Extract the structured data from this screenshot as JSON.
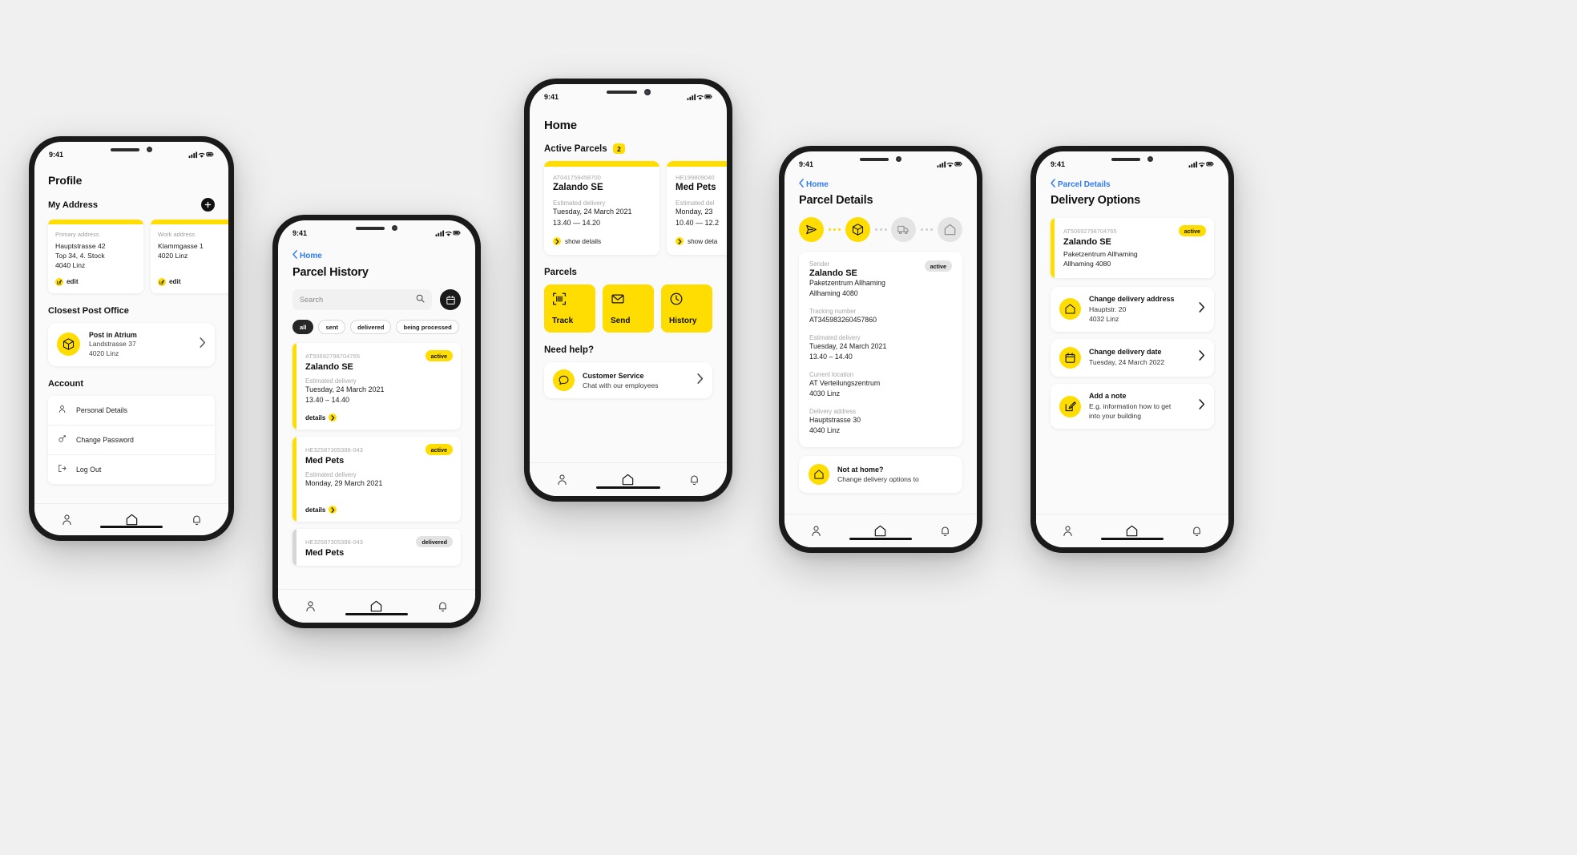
{
  "theme": {
    "accent": "#FFDD00",
    "bg": "#f0f0f0",
    "link": "#2e7bf6",
    "dark": "#1a1a1a"
  },
  "status_bar": {
    "time": "9:41"
  },
  "profile": {
    "title": "Profile",
    "my_address_heading": "My Address",
    "addresses": [
      {
        "label": "Primary address",
        "line1": "Hauptstrasse 42",
        "line2": "Top 34, 4. Stock",
        "line3": "4040 Linz",
        "edit": "edit"
      },
      {
        "label": "Work address",
        "line1": "Klammgasse 1",
        "line2": "4020 Linz",
        "line3": "",
        "edit": "edit"
      }
    ],
    "post_office_heading": "Closest Post Office",
    "post_office": {
      "name": "Post in Atrium",
      "street": "Landstrasse 37",
      "city": "4020 Linz"
    },
    "account_heading": "Account",
    "account_items": [
      {
        "label": "Personal Details",
        "icon": "person-icon"
      },
      {
        "label": "Change Password",
        "icon": "key-icon"
      },
      {
        "label": "Log Out",
        "icon": "logout-icon"
      }
    ]
  },
  "history": {
    "back": "Home",
    "title": "Parcel History",
    "search_placeholder": "Search",
    "calendar_icon": "calendar-icon",
    "filters": [
      {
        "label": "all",
        "selected": true
      },
      {
        "label": "sent",
        "selected": false
      },
      {
        "label": "delivered",
        "selected": false
      },
      {
        "label": "being processed",
        "selected": false
      }
    ],
    "parcels": [
      {
        "tracking": "AT50692798704765",
        "sender": "Zalando SE",
        "status": "active",
        "est_label": "Estimated delivery",
        "date": "Tuesday, 24 March 2021",
        "time": "13.40 – 14.40",
        "details": "details"
      },
      {
        "tracking": "HE32587305386-043",
        "sender": "Med Pets",
        "status": "active",
        "est_label": "Estimated delivery",
        "date": "Monday, 29 March 2021",
        "time": "",
        "details": "details"
      },
      {
        "tracking": "HE32587305386-043",
        "sender": "Med Pets",
        "status": "delivered",
        "est_label": "",
        "date": "",
        "time": "",
        "details": ""
      }
    ]
  },
  "home": {
    "title": "Home",
    "active_heading": "Active Parcels",
    "active_count": "2",
    "active_parcels": [
      {
        "tracking": "AT041759458700",
        "sender": "Zalando SE",
        "est_label": "Estimated delivery",
        "date": "Tuesday, 24 March 2021",
        "time": "13.40 — 14.20",
        "cta": "show details"
      },
      {
        "tracking": "HE199809040",
        "sender": "Med Pets",
        "est_label": "Estimated del",
        "date": "Monday, 23",
        "time": "10.40 — 12.2",
        "cta": "show deta"
      }
    ],
    "parcels_heading": "Parcels",
    "tiles": [
      {
        "label": "Track",
        "icon": "barcode-scan-icon"
      },
      {
        "label": "Send",
        "icon": "envelope-icon"
      },
      {
        "label": "History",
        "icon": "clock-icon"
      }
    ],
    "help_heading": "Need help?",
    "help_card": {
      "title": "Customer Service",
      "subtitle": "Chat with our employees",
      "icon": "chat-bubble-icon"
    }
  },
  "details": {
    "back": "Home",
    "title": "Parcel Details",
    "steps": [
      {
        "icon": "send-arrow-icon",
        "state": "on"
      },
      {
        "icon": "box-icon",
        "state": "on"
      },
      {
        "icon": "truck-icon",
        "state": "off"
      },
      {
        "icon": "home-icon",
        "state": "off"
      }
    ],
    "sender_label": "Sender",
    "sender_name": "Zalando SE",
    "sender_line1": "Paketzentrum Allhaming",
    "sender_line2": "Allhaming 4080",
    "status": "active",
    "fields": [
      {
        "label": "Tracking number",
        "value1": "AT345983260457860",
        "value2": ""
      },
      {
        "label": "Estimated delivery",
        "value1": "Tuesday, 24 March 2021",
        "value2": "13.40 – 14.40"
      },
      {
        "label": "Current location",
        "value1": "AT Verteilungszentrum",
        "value2": "4030 Linz"
      },
      {
        "label": "Delivery address",
        "value1": "Hauptstrasse 30",
        "value2": "4040 Linz"
      }
    ],
    "not_home": {
      "title": "Not at home?",
      "subtitle": "Change delivery options to",
      "icon": "home-icon"
    }
  },
  "delivery_options": {
    "back": "Parcel Details",
    "title": "Delivery Options",
    "parcel": {
      "tracking": "AT50692798704765",
      "sender": "Zalando SE",
      "status": "active",
      "line1": "Paketzentrum Allhaming",
      "line2": "Allhaming 4080"
    },
    "options": [
      {
        "title": "Change delivery address",
        "sub1": "Hauptstr. 20",
        "sub2": "4032 Linz",
        "icon": "home-icon"
      },
      {
        "title": "Change delivery date",
        "sub1": "Tuesday, 24 March 2022",
        "sub2": "",
        "icon": "calendar-icon"
      },
      {
        "title": "Add a note",
        "sub1": "E.g. information how to get",
        "sub2": "into your building",
        "icon": "edit-note-icon"
      }
    ]
  },
  "tabbar": {
    "items": [
      {
        "name": "profile",
        "icon": "person-icon"
      },
      {
        "name": "home",
        "icon": "home-icon"
      },
      {
        "name": "notifications",
        "icon": "bell-icon"
      }
    ]
  }
}
